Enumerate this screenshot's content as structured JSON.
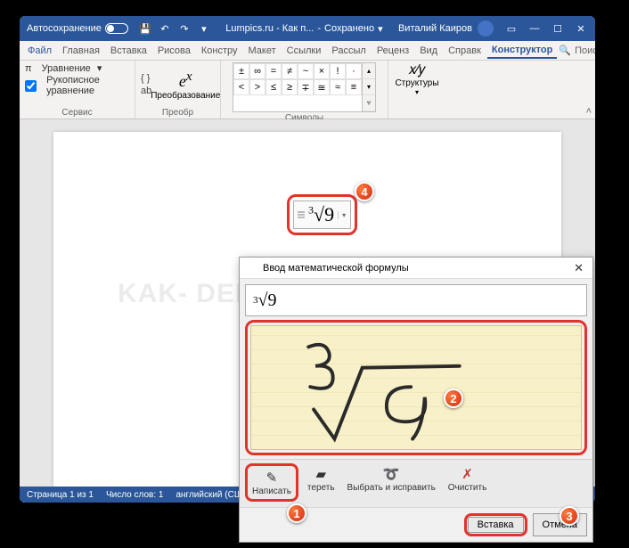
{
  "titlebar": {
    "autosave": "Автосохранение",
    "docname": "Lumpics.ru - Как п...",
    "saved": "Сохранено",
    "user": "Виталий Каиров"
  },
  "tabs": {
    "file": "Файл",
    "items": [
      "Главная",
      "Вставка",
      "Рисова",
      "Констру",
      "Макет",
      "Ссылки",
      "Рассыл",
      "Реценз",
      "Вид",
      "Справк"
    ],
    "active": "Конструктор",
    "search": "Поиск"
  },
  "ribbon": {
    "g1": {
      "eq": "Уравнение",
      "ink": "Рукописное уравнение",
      "label": "Сервис"
    },
    "g2": {
      "convert": "Преобразование",
      "label": "Преобр"
    },
    "g3": {
      "label": "Символы"
    },
    "g4": {
      "structures": "Структуры"
    }
  },
  "symbols": [
    "±",
    "∞",
    "=",
    "≠",
    "~",
    "×",
    "!",
    "·",
    "<",
    ">",
    "≤",
    "≥",
    "∓",
    "≅",
    "≈",
    "≡"
  ],
  "equation": {
    "display": "∛9",
    "index": "3",
    "radicand": "9"
  },
  "statusbar": {
    "page": "Страница 1 из 1",
    "words": "Число слов: 1",
    "lang": "английский (США"
  },
  "watermark": "KAK-    DELAT.ORG",
  "dialog": {
    "title": "Ввод математической формулы",
    "preview_index": "3",
    "preview_radicand": "9",
    "tools": {
      "write": "Написать",
      "erase": "тереть",
      "select": "Выбрать и исправить",
      "clear": "Очистить"
    },
    "insert": "Вставка",
    "cancel": "Отмена"
  },
  "callouts": {
    "c1": "1",
    "c2": "2",
    "c3": "3",
    "c4": "4"
  }
}
